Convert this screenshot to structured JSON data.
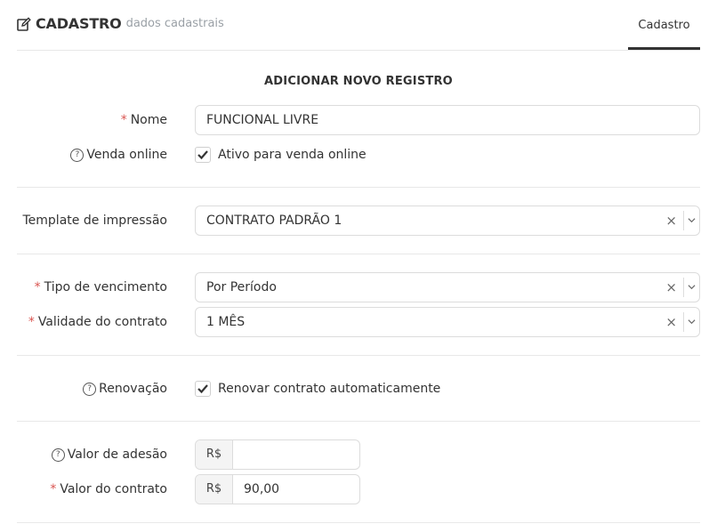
{
  "header": {
    "title": "CADASTRO",
    "subtitle": "dados cadastrais",
    "tab_label": "Cadastro"
  },
  "form": {
    "section_title": "ADICIONAR NOVO REGISTRO",
    "required_mark": "*",
    "help_glyph": "?",
    "nome": {
      "label": "Nome",
      "value": "FUNCIONAL LIVRE"
    },
    "venda_online": {
      "label": "Venda online",
      "checkbox_label": "Ativo para venda online",
      "checked": true
    },
    "template": {
      "label": "Template de impressão",
      "value": "CONTRATO PADRÃO 1",
      "clear": "×"
    },
    "tipo_vencimento": {
      "label": "Tipo de vencimento",
      "value": "Por Período",
      "clear": "×"
    },
    "validade": {
      "label": "Validade do contrato",
      "value": "1 MÊS",
      "clear": "×"
    },
    "renovacao": {
      "label": "Renovação",
      "checkbox_label": "Renovar contrato automaticamente",
      "checked": true
    },
    "valor_adesao": {
      "label": "Valor de adesão",
      "currency": "R$",
      "value": ""
    },
    "valor_contrato": {
      "label": "Valor do contrato",
      "currency": "R$",
      "value": "90,00"
    }
  },
  "icons": {
    "title": "edit-icon",
    "help": "help-circle-icon",
    "check": "check-icon",
    "clear": "clear-icon",
    "dropdown": "chevron-down-icon"
  }
}
